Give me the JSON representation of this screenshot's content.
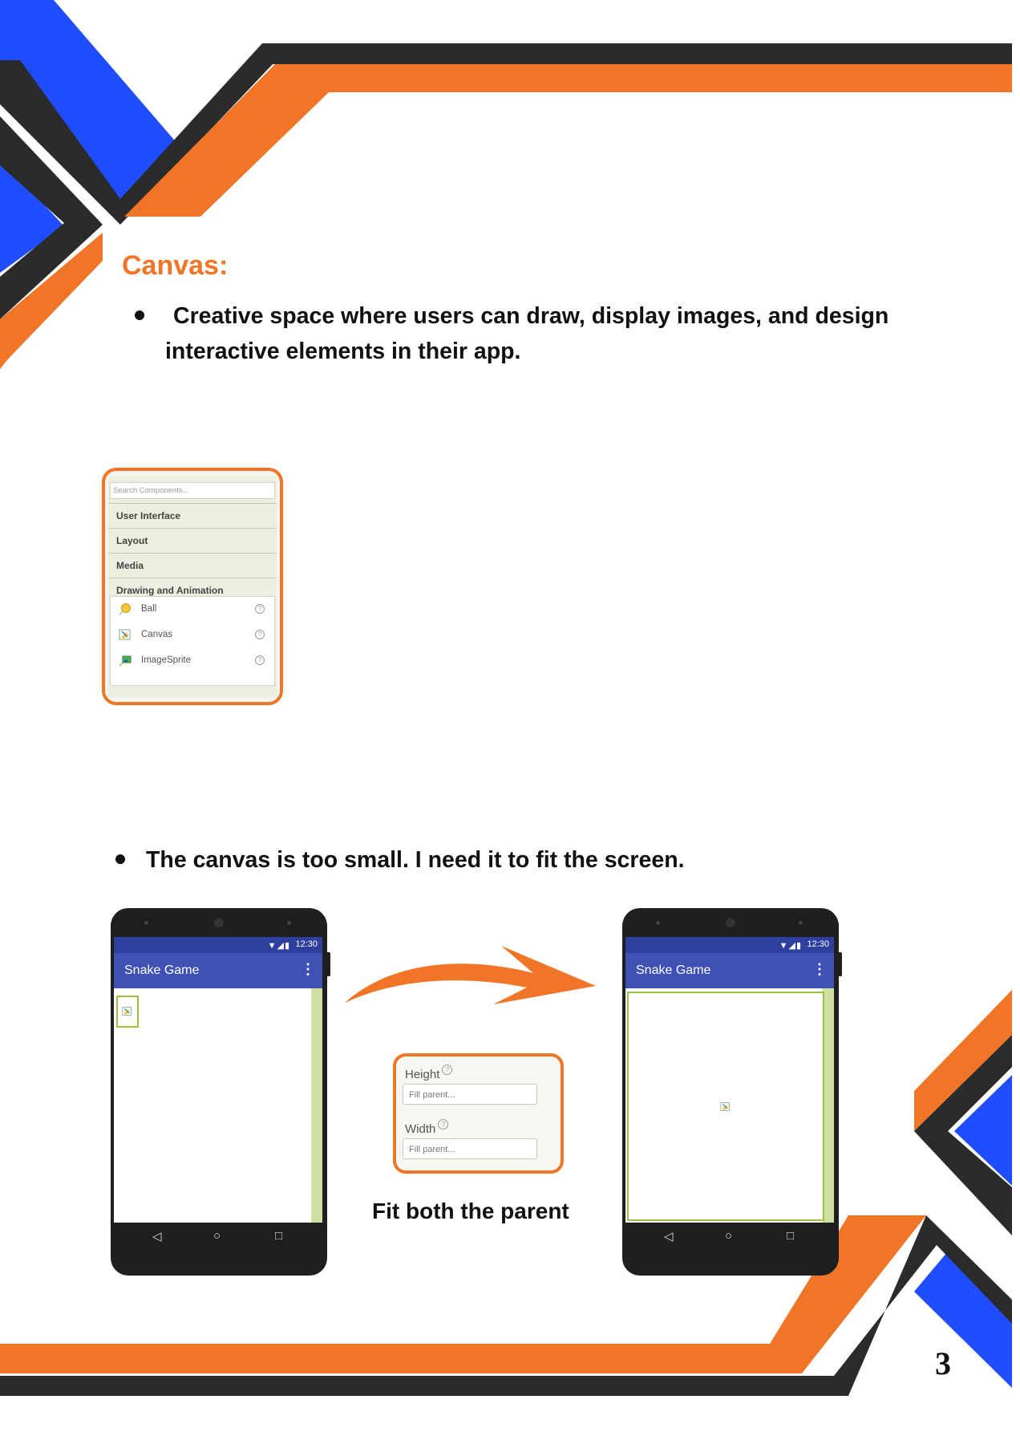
{
  "section": {
    "heading": "Canvas:",
    "bullet1_line1": "Creative space where users can draw, display images, and design",
    "bullet1_line2": "interactive elements in their app.",
    "bullet2": "The canvas is too small. I need it to fit the screen."
  },
  "palette": {
    "search_placeholder": "Search Components...",
    "categories": [
      "User Interface",
      "Layout",
      "Media",
      "Drawing and Animation"
    ],
    "items": [
      {
        "label": "Ball",
        "icon": "ball-icon"
      },
      {
        "label": "Canvas",
        "icon": "canvas-icon"
      },
      {
        "label": "ImageSprite",
        "icon": "imagesprite-icon"
      }
    ],
    "help_glyph": "?"
  },
  "phone_left": {
    "time": "12:30",
    "signal": "▼◢▮",
    "app_title": "Snake Game",
    "menu_glyph": "⋮",
    "nav": [
      "◁",
      "○",
      "□"
    ]
  },
  "phone_right": {
    "time": "12:30",
    "signal": "▼◢▮",
    "app_title": "Snake Game",
    "menu_glyph": "⋮",
    "nav": [
      "◁",
      "○",
      "□"
    ]
  },
  "properties": {
    "height_label": "Height",
    "height_value": "Fill parent...",
    "width_label": "Width",
    "width_value": "Fill parent..."
  },
  "caption": "Fit both the parent",
  "page_number": "3",
  "colors": {
    "orange": "#f07526",
    "blue": "#1f4dff",
    "dark": "#2b2b2b",
    "app_bar": "#3f51b5",
    "canvas_border": "#9ac33c"
  }
}
